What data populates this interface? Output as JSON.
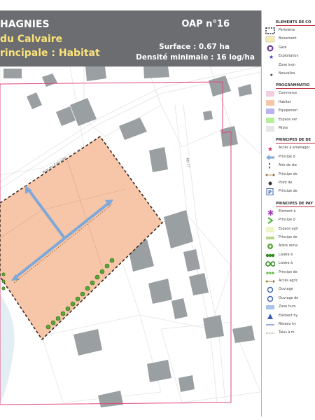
{
  "header": {
    "commune": "HAGNIES",
    "site": "du Calvaire",
    "vocation": "rincipale : Habitat",
    "oap_number": "OAP n°16",
    "surface": "Surface : 0.67 ha",
    "density": "Densité minimale : 16 log/ha"
  },
  "map_labels": {
    "street": "Rue du Calvaire",
    "road": "RD 17"
  },
  "legend": {
    "sections": [
      {
        "title": "ELEMENTS DE CO",
        "items": [
          {
            "icon": "dashed-frame-icon",
            "label": "Périmètre"
          },
          {
            "icon": "woodland-swatch-icon",
            "label": "Boisement"
          },
          {
            "icon": "station-circle-icon",
            "label": "Gare"
          },
          {
            "icon": "star-icon",
            "label": "Exploitation"
          },
          {
            "icon": "blank-icon",
            "label": "Zone inon"
          },
          {
            "icon": "small-star-icon",
            "label": "Nouvelles"
          }
        ]
      },
      {
        "title": "PROGRAMMATIO",
        "items": [
          {
            "icon": "commerce-swatch-icon",
            "label": "Commerce"
          },
          {
            "icon": "habitat-swatch-icon",
            "label": "Habitat"
          },
          {
            "icon": "equipment-swatch-icon",
            "label": "Equipemen"
          },
          {
            "icon": "green-space-swatch-icon",
            "label": "Espace ver"
          },
          {
            "icon": "mixed-swatch-icon",
            "label": "Mixte"
          }
        ]
      },
      {
        "title": "PRINCIPES DE DE",
        "items": [
          {
            "icon": "access-star-icon",
            "label": "Accès à aménager"
          },
          {
            "icon": "blue-arrow-icon",
            "label": "Principe d"
          },
          {
            "icon": "parking-dots-icon",
            "label": "Aire de sta"
          },
          {
            "icon": "brown-arrow-icon",
            "label": "Principe de"
          },
          {
            "icon": "point-icon",
            "label": "Point de"
          },
          {
            "icon": "parking-p-icon",
            "label": "Principe de"
          }
        ]
      },
      {
        "title": "PRINCIPES DE PAY",
        "items": [
          {
            "icon": "purple-asterisk-icon",
            "label": "Elément à"
          },
          {
            "icon": "green-chevron-icon",
            "label": "Principe d"
          },
          {
            "icon": "pale-green-swatch-icon",
            "label": "Espace agri"
          },
          {
            "icon": "green-band-icon",
            "label": "Principe de"
          },
          {
            "icon": "tree-circle-icon",
            "label": "Arbre rema"
          },
          {
            "icon": "hedge-line-icon",
            "label": "Lisière à"
          },
          {
            "icon": "double-circle-icon",
            "label": "Lisière à"
          },
          {
            "icon": "green-dots-icon",
            "label": "Principe de"
          },
          {
            "icon": "double-arrow-icon",
            "label": "Accès agric"
          },
          {
            "icon": "blue-ring-icon",
            "label": "Ouvrage"
          },
          {
            "icon": "blue-ring-icon",
            "label": "Ouvrage de"
          },
          {
            "icon": "blue-band-icon",
            "label": "Zone hum"
          },
          {
            "icon": "triangle-icon",
            "label": "Elément hy"
          },
          {
            "icon": "blue-line-icon",
            "label": "Réseau hy"
          },
          {
            "icon": "dotted-line-icon",
            "label": "Talus à m"
          }
        ]
      }
    ]
  },
  "colors": {
    "header_bg": "#6b6d70",
    "header_accent": "#fbe37a",
    "habitat_fill": "#f7c6a8",
    "building": "#9aa0a2",
    "perimeter": "#e0477a",
    "access_arrow": "#7fa8d8",
    "hedge": "#5aa638"
  }
}
